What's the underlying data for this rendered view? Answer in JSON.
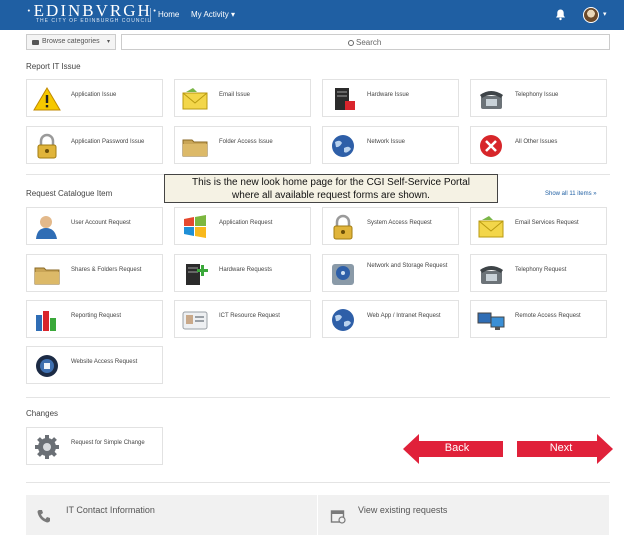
{
  "header": {
    "logo": "·EDINBVRGH·",
    "logo_sub": "THE CITY OF EDINBURGH COUNCIL",
    "nav_home": "Home",
    "nav_activity": "My Activity ▾",
    "avatar_caret": "▾"
  },
  "servicebar": {
    "category_label": "Browse categories",
    "category_caret": "▾",
    "search_placeholder": "Search"
  },
  "sections": {
    "report": "Report IT Issue",
    "catalogue": "Request Catalogue Item",
    "show_all": "Show all 11 items »",
    "changes": "Changes"
  },
  "report_items": [
    {
      "label": "Application Issue",
      "icon": "warning-icon"
    },
    {
      "label": "Email Issue",
      "icon": "envelope-icon"
    },
    {
      "label": "Hardware Issue",
      "icon": "server-icon"
    },
    {
      "label": "Telephony Issue",
      "icon": "telephone-icon"
    },
    {
      "label": "Application Password Issue",
      "icon": "padlock-icon"
    },
    {
      "label": "Folder Access Issue",
      "icon": "folder-icon"
    },
    {
      "label": "Network Issue",
      "icon": "globe-icon"
    },
    {
      "label": "All Other Issues",
      "icon": "error-icon"
    }
  ],
  "catalogue_items": [
    {
      "label": "User Account Request",
      "icon": "user-icon"
    },
    {
      "label": "Application Request",
      "icon": "windows-icon"
    },
    {
      "label": "System Access Request",
      "icon": "padlock-icon"
    },
    {
      "label": "Email Services Request",
      "icon": "envelope-icon"
    },
    {
      "label": "Shares & Folders Request",
      "icon": "folder-icon"
    },
    {
      "label": "Hardware Requests",
      "icon": "hardware-add-icon"
    },
    {
      "label": "Network and Storage Request",
      "icon": "storage-icon"
    },
    {
      "label": "Telephony Request",
      "icon": "telephone-icon"
    },
    {
      "label": "Reporting Request",
      "icon": "chart-icon"
    },
    {
      "label": "ICT Resource Request",
      "icon": "id-card-icon"
    },
    {
      "label": "Web App / Intranet Request",
      "icon": "globe-icon"
    },
    {
      "label": "Remote Access Request",
      "icon": "remote-computer-icon"
    },
    {
      "label": "Website Access Request",
      "icon": "website-icon"
    }
  ],
  "change_items": [
    {
      "label": "Request for Simple Change",
      "icon": "gear-icon"
    }
  ],
  "tooltip": {
    "line1": "This is the new look home page for the CGI Self-Service Portal",
    "line2": "where all available request forms are shown."
  },
  "nav_buttons": {
    "back": "Back",
    "next": "Next"
  },
  "footer": {
    "contact": "IT Contact Information",
    "view_requests": "View existing requests"
  },
  "colors": {
    "header": "#1f5fa3",
    "arrow": "#e0213a"
  }
}
